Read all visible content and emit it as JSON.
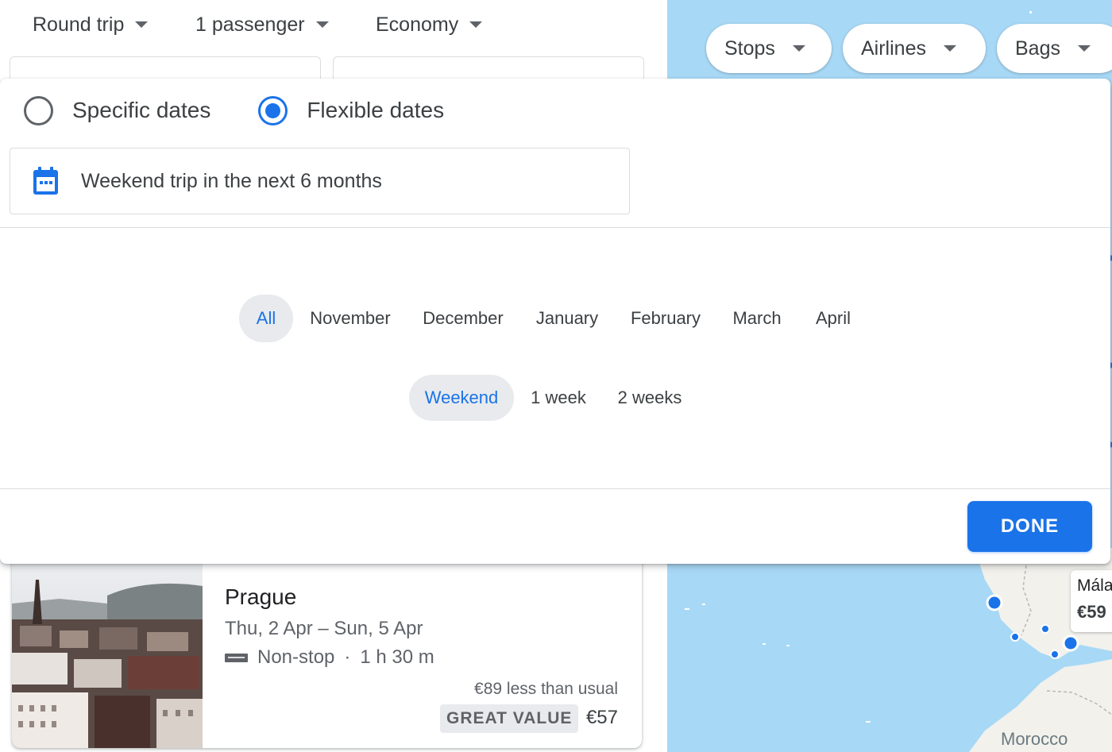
{
  "search_options": {
    "trip_type": "Round trip",
    "passengers": "1 passenger",
    "cabin_class": "Economy"
  },
  "filters": {
    "stops": "Stops",
    "airlines": "Airlines",
    "bags": "Bags"
  },
  "date_mode": {
    "specific_label": "Specific dates",
    "flexible_label": "Flexible dates",
    "selected": "flexible"
  },
  "trip_summary": "Weekend trip in the next 6 months",
  "months": [
    "All",
    "November",
    "December",
    "January",
    "February",
    "March",
    "April"
  ],
  "selected_month": "All",
  "durations": [
    "Weekend",
    "1 week",
    "2 weeks"
  ],
  "selected_duration": "Weekend",
  "done_label": "DONE",
  "result": {
    "destination": "Prague",
    "dates": "Thu, 2 Apr – Sun, 5 Apr",
    "stops": "Non-stop",
    "separator": "·",
    "duration": "1 h 30 m",
    "deal_note": "€89 less than usual",
    "badge": "GREAT VALUE",
    "price": "€57"
  },
  "map": {
    "country_label": "Morocco",
    "pin_city": "Mála",
    "pin_price": "€59"
  },
  "colors": {
    "accent": "#1a73e8",
    "map_water": "#a7d8f6",
    "map_land": "#f2f1ec",
    "pill_selected_bg": "#e8eaed"
  },
  "icons": {
    "dropdown": "caret-down-icon",
    "calendar": "calendar-icon",
    "airline": "airline-logo-icon"
  }
}
